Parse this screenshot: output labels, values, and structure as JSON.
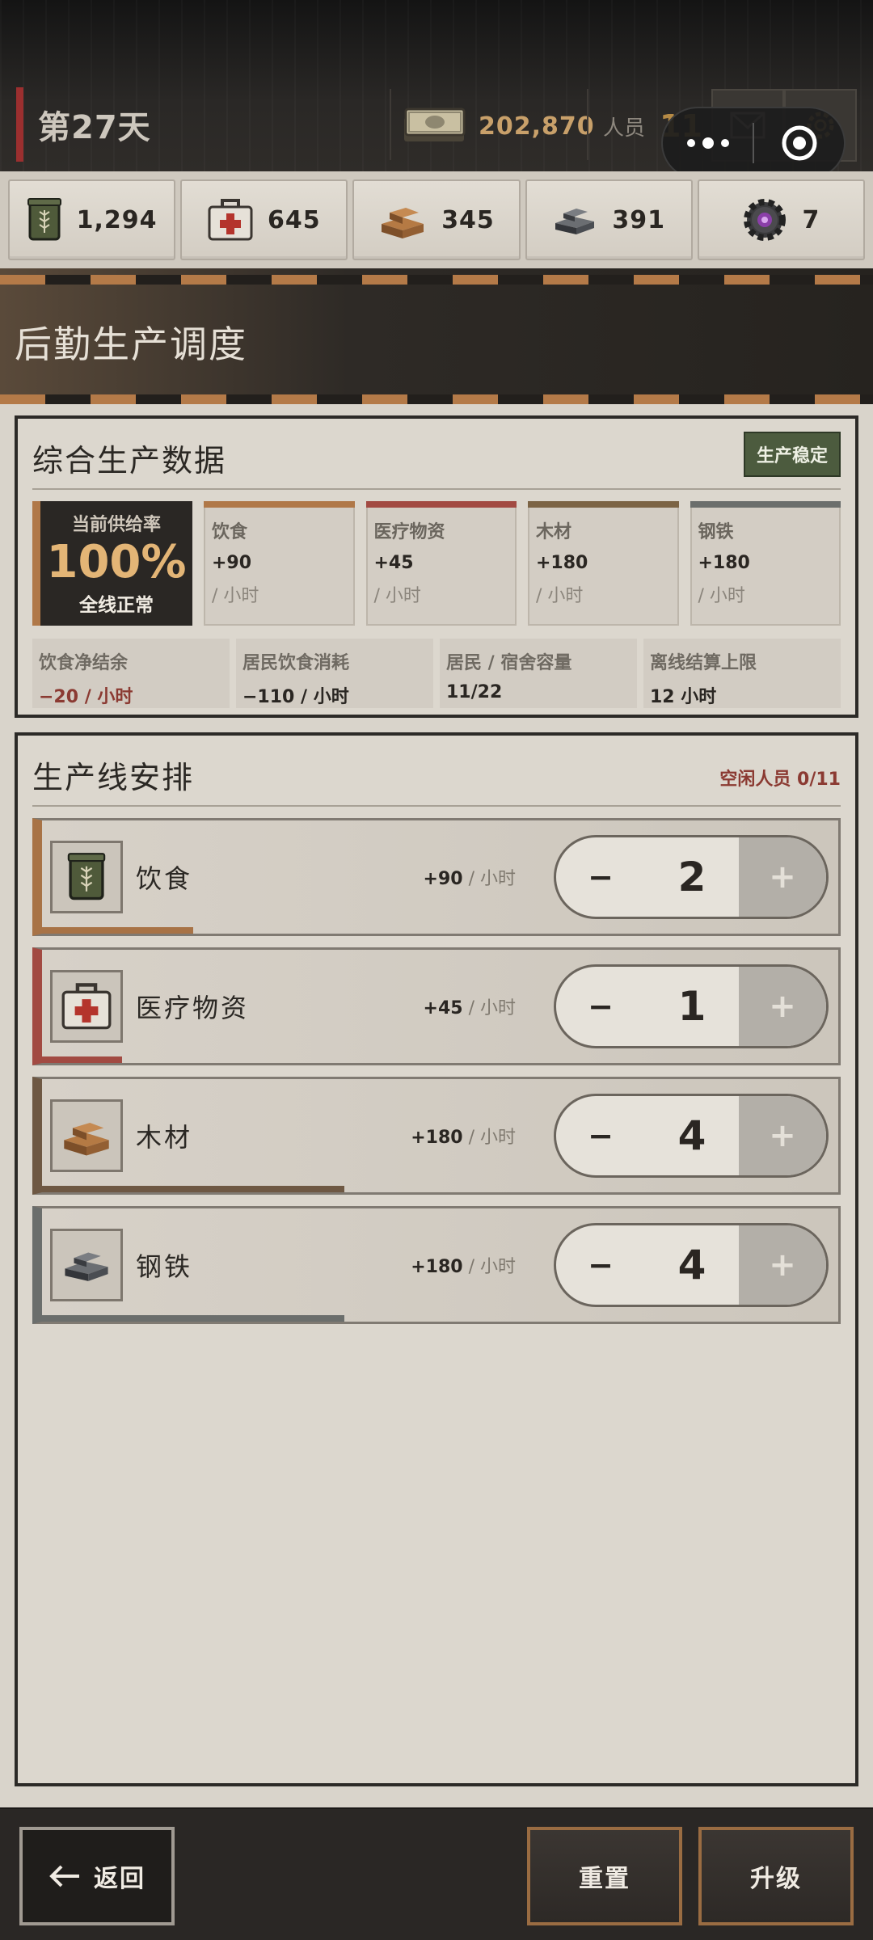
{
  "header": {
    "day": "第27天",
    "money": "202,870",
    "staff_label": "人员",
    "staff_count": "11"
  },
  "resources": [
    {
      "icon": "food-can-icon",
      "value": "1,294"
    },
    {
      "icon": "medkit-icon",
      "value": "645"
    },
    {
      "icon": "wood-icon",
      "value": "345"
    },
    {
      "icon": "steel-icon",
      "value": "391"
    },
    {
      "icon": "gear-core-icon",
      "value": "7"
    }
  ],
  "page_title": "后勤生产调度",
  "overview": {
    "title": "综合生产数据",
    "status_badge": "生产稳定",
    "supply": {
      "label": "当前供给率",
      "value": "100%",
      "status": "全线正常"
    },
    "stats": [
      {
        "name": "饮食",
        "value": "+90",
        "unit": "/ 小时",
        "color": "#b07848"
      },
      {
        "name": "医疗物资",
        "value": "+45",
        "unit": "/ 小时",
        "color": "#a24a42"
      },
      {
        "name": "木材",
        "value": "+180",
        "unit": "/ 小时",
        "color": "#7c6445"
      },
      {
        "name": "钢铁",
        "value": "+180",
        "unit": "/ 小时",
        "color": "#6b6e6c"
      }
    ],
    "summary": [
      {
        "key": "饮食净结余",
        "value": "−20",
        "sep": " / ",
        "unit": "小时"
      },
      {
        "key": "居民饮食消耗",
        "value": "−110",
        "sep": " / ",
        "unit": "小时"
      },
      {
        "key": "居民 / 宿舍容量",
        "value": "11/22",
        "sep": "",
        "unit": ""
      },
      {
        "key": "离线结算上限",
        "value": "12",
        "sep": " ",
        "unit": "小时"
      }
    ]
  },
  "production": {
    "title": "生产线安排",
    "idle": "空闲人员 0/11",
    "lines": [
      {
        "name": "饮食",
        "rate": "+90",
        "unit": " / 小时",
        "count": "2",
        "minus": "−",
        "plus": "+",
        "color": "#a87346",
        "progress": 0.19
      },
      {
        "name": "医疗物资",
        "rate": "+45",
        "unit": " / 小时",
        "count": "1",
        "minus": "−",
        "plus": "+",
        "color": "#a24a42",
        "progress": 0.1
      },
      {
        "name": "木材",
        "rate": "+180",
        "unit": " / 小时",
        "count": "4",
        "minus": "−",
        "plus": "+",
        "color": "#6e5843",
        "progress": 0.38
      },
      {
        "name": "钢铁",
        "rate": "+180",
        "unit": " / 小时",
        "count": "4",
        "minus": "−",
        "plus": "+",
        "color": "#6b6e6c",
        "progress": 0.38
      }
    ]
  },
  "footer": {
    "back": "返回",
    "reset": "重置",
    "upgrade": "升级"
  }
}
